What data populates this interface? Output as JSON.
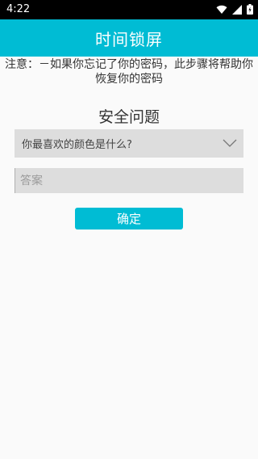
{
  "status_bar": {
    "time": "4:22",
    "icons": [
      "wifi-icon",
      "cellular-signal-icon",
      "battery-icon"
    ]
  },
  "app_bar": {
    "title": "时间锁屏",
    "color": "#00bcd4"
  },
  "notice": {
    "text": "注意：－如果你忘记了你的密码，此步骤将帮助你恢复你的密码"
  },
  "security": {
    "title": "安全问题",
    "question": "你最喜欢的颜色是什么?",
    "question_icon": "chevron-down-icon",
    "answer_placeholder": "答案",
    "answer_value": "",
    "confirm_label": "确定"
  }
}
